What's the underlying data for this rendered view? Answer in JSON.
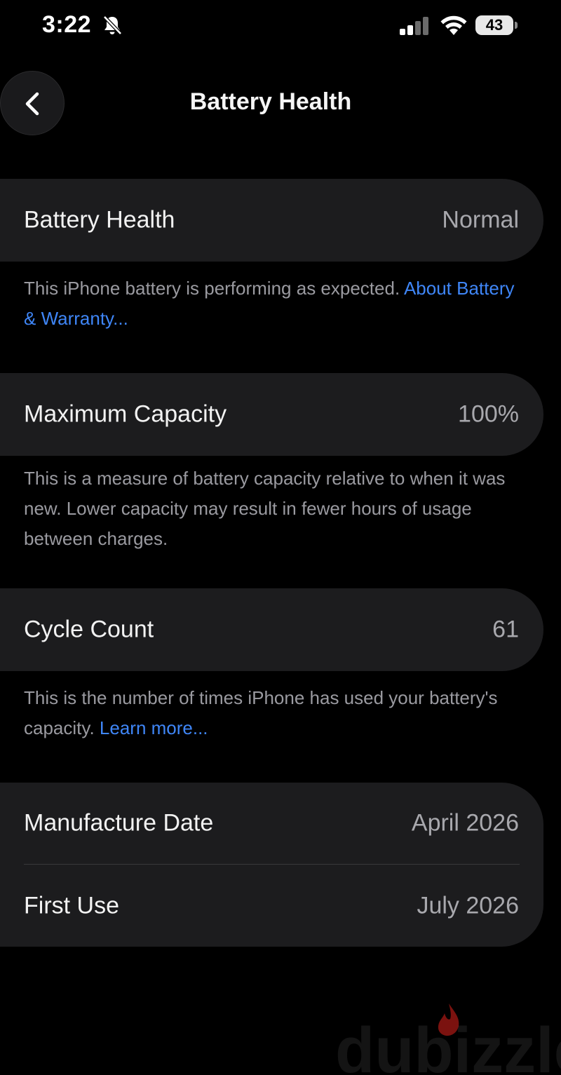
{
  "status_bar": {
    "time": "3:22",
    "battery_level": "43",
    "icons": [
      "bell-slash-icon",
      "signal-icon",
      "wifi-icon",
      "battery-icon"
    ]
  },
  "nav": {
    "title": "Battery Health",
    "back_icon": "chevron-left-icon"
  },
  "battery_health": {
    "label": "Battery Health",
    "value": "Normal",
    "footnote": "This iPhone battery is performing as expected. ",
    "footnote_link": "About Battery & Warranty..."
  },
  "maximum_capacity": {
    "label": "Maximum Capacity",
    "value": "100%",
    "footnote": "This is a measure of battery capacity relative to when it was new. Lower capacity may result in fewer hours of usage between charges."
  },
  "cycle_count": {
    "label": "Cycle Count",
    "value": "61",
    "footnote": "This is the number of times iPhone has used your battery's capacity. ",
    "footnote_link": "Learn more..."
  },
  "dates": {
    "manufacture_label": "Manufacture Date",
    "manufacture_value": "April 2026",
    "first_use_label": "First Use",
    "first_use_value": "July 2026"
  },
  "watermark": {
    "text": "dubizzle",
    "accent_color": "#e0201b"
  },
  "colors": {
    "background": "#000000",
    "cell": "#1c1c1e",
    "link": "#3f86f7",
    "secondary_text": "#9a9aa0"
  }
}
